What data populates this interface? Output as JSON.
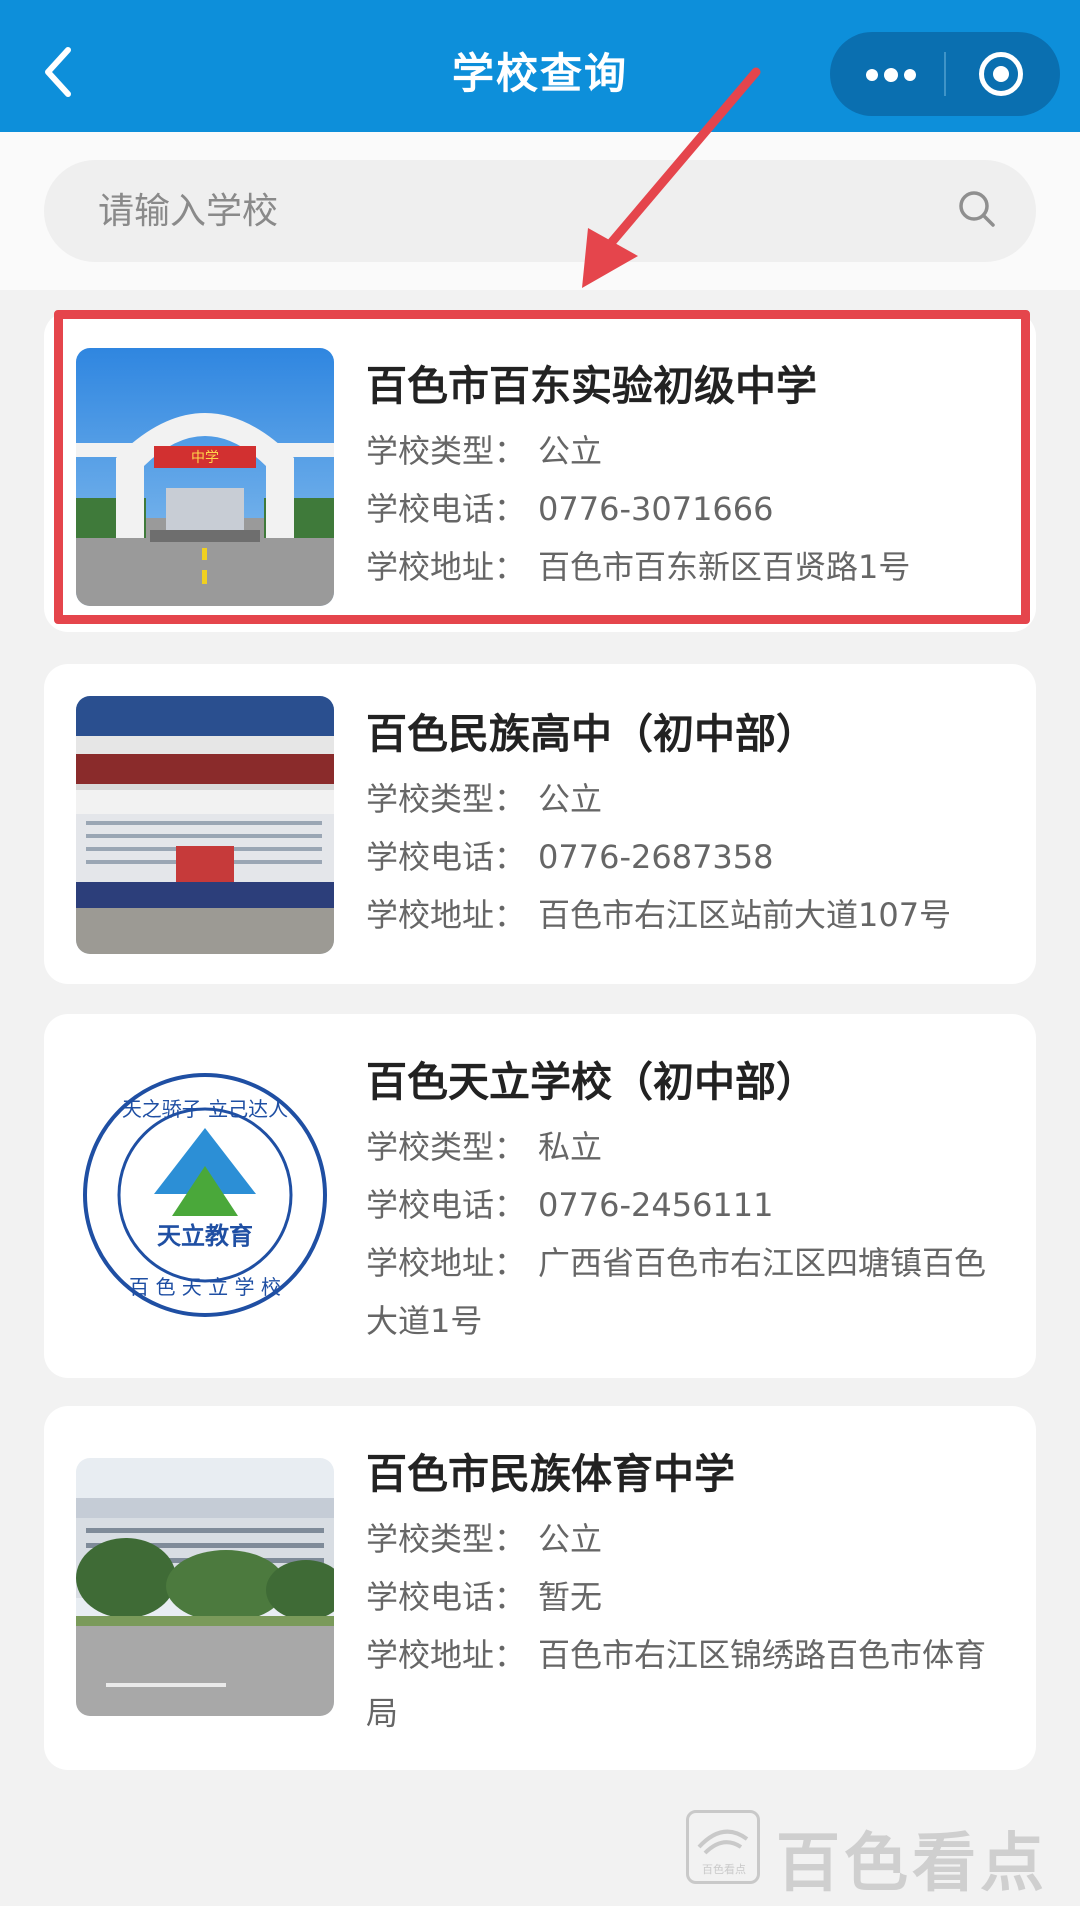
{
  "header": {
    "title": "学校查询",
    "background": "#0d8fda"
  },
  "search": {
    "placeholder": "请输入学校",
    "value": ""
  },
  "labels": {
    "type": "学校类型：",
    "phone": "学校电话：",
    "address": "学校地址："
  },
  "schools": [
    {
      "name": "百色市百东实验初级中学",
      "type": "公立",
      "phone": "0776-3071666",
      "address": "百色市百东新区百贤路1号",
      "photo_caption": "中学",
      "highlighted": true
    },
    {
      "name": "百色民族高中（初中部）",
      "type": "公立",
      "phone": "0776-2687358",
      "address": "百色市右江区站前大道107号",
      "highlighted": false
    },
    {
      "name": "百色天立学校（初中部）",
      "type": "私立",
      "phone": "0776-2456111",
      "address": "广西省百色市右江区四塘镇百色大道1号",
      "logo_text": "天立教育",
      "logo_ring_text": "天之骄子 立己达人 百色天立学校",
      "highlighted": false
    },
    {
      "name": "百色市民族体育中学",
      "type": "公立",
      "phone": "暂无",
      "address": "百色市右江区锦绣路百色市体育局",
      "highlighted": false
    }
  ],
  "watermark": {
    "text": "百色看点",
    "logo_small": "百色看点"
  },
  "colors": {
    "highlight": "#e5454c",
    "accent": "#0d8fda"
  }
}
